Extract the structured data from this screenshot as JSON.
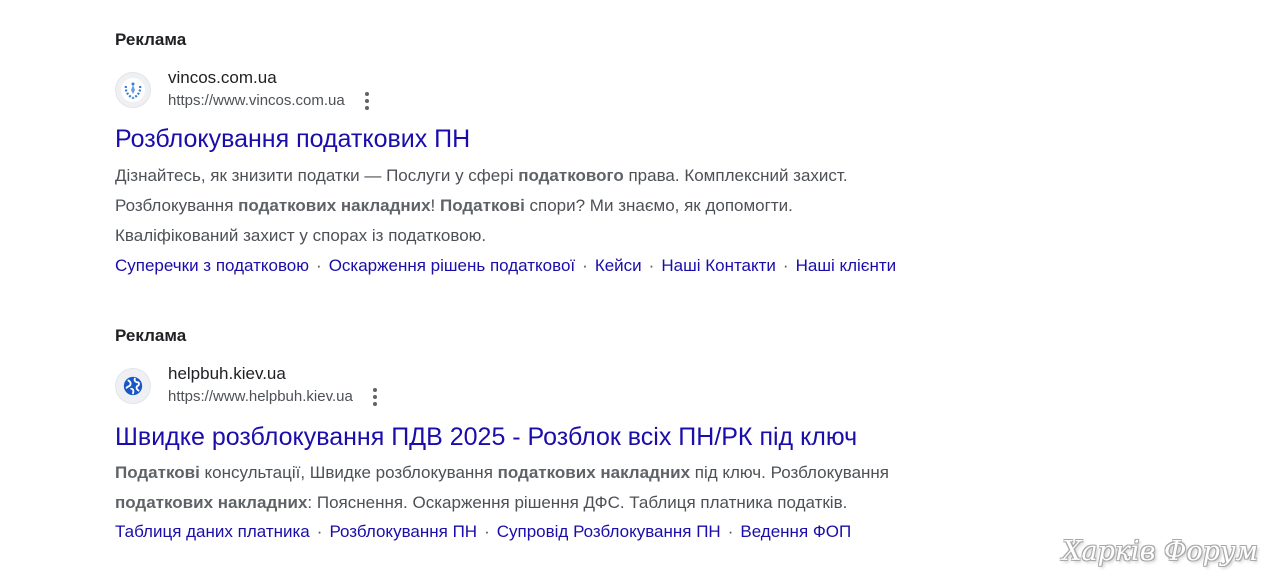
{
  "ads": [
    {
      "label": "Реклама",
      "site_name": "vincos.com.ua",
      "site_url": "https://www.vincos.com.ua",
      "title": "Розблокування податкових ПН",
      "description_lines": [
        [
          {
            "text": "Дізнайтесь, як знизити податки — Послуги у сфері ",
            "bold": false
          },
          {
            "text": "податкового",
            "bold": true
          },
          {
            "text": " права. Комплексний захист.",
            "bold": false
          }
        ],
        [
          {
            "text": "Розблокування ",
            "bold": false
          },
          {
            "text": "податкових накладних",
            "bold": true
          },
          {
            "text": "! ",
            "bold": false
          },
          {
            "text": "Податкові",
            "bold": true
          },
          {
            "text": " спори? Ми знаємо, як допомогти.",
            "bold": false
          }
        ],
        [
          {
            "text": "Кваліфікований захист у спорах із податковою.",
            "bold": false
          }
        ]
      ],
      "sitelinks": [
        "Суперечки з податковою",
        "Оскарження рішень податкової",
        "Кейси",
        "Наші Контакти",
        "Наші клієнти"
      ],
      "favicon": "laurel-wreath-logo-icon"
    },
    {
      "label": "Реклама",
      "site_name": "helpbuh.kiev.ua",
      "site_url": "https://www.helpbuh.kiev.ua",
      "title": "Швидке розблокування ПДВ 2025 - Розблок всіх ПН/РК під ключ",
      "description_lines": [
        [
          {
            "text": "Податкові",
            "bold": true
          },
          {
            "text": " консультації, Швидке розблокування ",
            "bold": false
          },
          {
            "text": "податкових накладних",
            "bold": true
          },
          {
            "text": " під ключ. Розблокування",
            "bold": false
          }
        ],
        [
          {
            "text": "податкових накладних",
            "bold": true
          },
          {
            "text": ": Пояснення. Оскарження рішення ДФС. Таблиця платника податків.",
            "bold": false
          }
        ]
      ],
      "sitelinks": [
        "Таблиця даних платника",
        "Розблокування ПН",
        "Супровід Розблокування ПН",
        "Ведення ФОП"
      ],
      "favicon": "globe-icon"
    }
  ],
  "sitelink_separator": "·",
  "watermark": "Харків Форум",
  "colors": {
    "link": "#1a0dab",
    "text": "#202124",
    "muted": "#4d5156",
    "globe": "#1a57c6"
  }
}
